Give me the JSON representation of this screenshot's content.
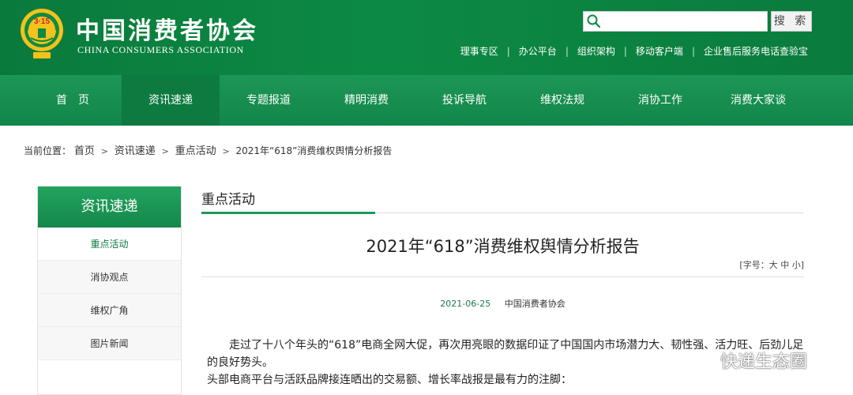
{
  "header": {
    "logo_text": "3·15",
    "brand_cn": "中国消费者协会",
    "brand_en": "CHINA CONSUMERS ASSOCIATION",
    "search": {
      "placeholder": "",
      "button_label": "搜 索"
    },
    "toplinks": [
      "理事专区",
      "办公平台",
      "组织架构",
      "移动客户端",
      "企业售后服务电话查验宝"
    ],
    "link_separator": "|"
  },
  "nav": {
    "items": [
      "首　页",
      "资讯速递",
      "专题报道",
      "精明消费",
      "投诉导航",
      "维权法规",
      "消协工作",
      "消费大家谈"
    ],
    "active_index": 1
  },
  "breadcrumb": {
    "prefix": "当前位置：",
    "items": [
      "首页",
      "资讯速递",
      "重点活动"
    ],
    "current": "2021年“618”消费维权舆情分析报告",
    "arrow": ">"
  },
  "sidebar": {
    "title": "资讯速递",
    "items": [
      "重点活动",
      "消协观点",
      "维权广角",
      "图片新闻"
    ],
    "active_index": 0
  },
  "main": {
    "section_title": "重点活动",
    "article_title": "2021年“618”消费维权舆情分析报告",
    "font_size": {
      "open": "[",
      "label": "字号：",
      "large": "大",
      "medium": "中",
      "small": "小",
      "close": "]"
    },
    "date": "2021-06-25",
    "source": "中国消费者协会",
    "para1": "走过了十八个年头的“618”电商全网大促，再次用亮眼的数据印证了中国国内市场潜力大、韧性强、活力旺、后劲儿足的良好势头。",
    "para2": "头部电商平台与活跃品牌接连晒出的交易额、增长率战报是最有力的注脚："
  },
  "watermark": {
    "text": "快递生态圈"
  },
  "colors": {
    "brand_green": "#0c8a44",
    "nav_green": "#12864a",
    "active_green": "#0d7a40",
    "date_green": "#1d7a48"
  }
}
